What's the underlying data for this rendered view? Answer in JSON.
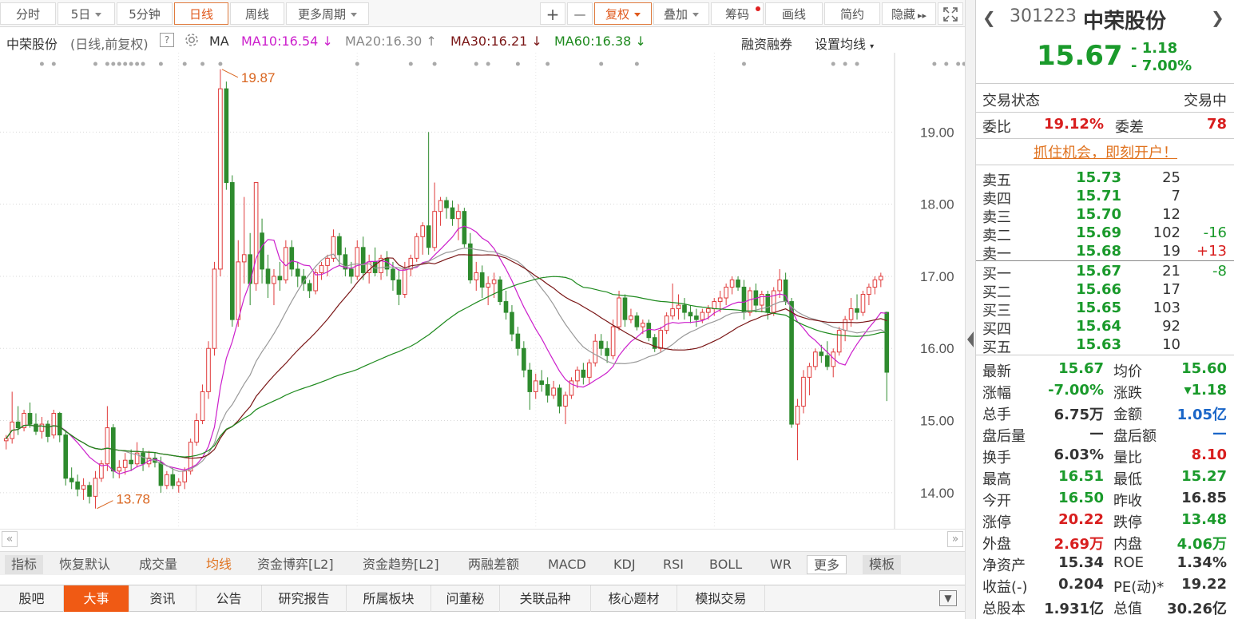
{
  "toolbar": {
    "tabs": [
      "分时",
      "5日",
      "5分钟",
      "日线",
      "周线",
      "更多周期"
    ],
    "right": [
      "+",
      "—",
      "复权",
      "叠加",
      "筹码",
      "画线",
      "简约",
      "隐藏"
    ]
  },
  "ma": {
    "title": "中荣股份",
    "subtitle": "(日线,前复权)",
    "help": "?",
    "ma": "MA",
    "ma10": "MA10:16.54",
    "ma20": "MA20:16.30",
    "ma30": "MA30:16.21",
    "ma60": "MA60:16.38",
    "rzrq": "融资融券",
    "setma": "设置均线"
  },
  "colors": {
    "up": "#e03b3b",
    "down": "#2e8b2e",
    "ma10": "#cc1fcc",
    "ma20": "#999999",
    "ma30": "#7a1616",
    "ma60": "#1e8a1e",
    "hl": "#d9651f"
  },
  "chart_data": {
    "type": "candlestick",
    "y_ticks": [
      "19.00",
      "18.00",
      "17.00",
      "16.00",
      "15.00",
      "14.00"
    ],
    "ylim": [
      13.5,
      20.1
    ],
    "high_label": "19.87",
    "low_label": "13.78",
    "ohlc": [
      [
        14.72,
        14.8,
        14.6,
        14.75
      ],
      [
        14.75,
        15.4,
        14.68,
        14.98
      ],
      [
        14.98,
        15.2,
        14.8,
        14.9
      ],
      [
        14.9,
        15.15,
        14.85,
        15.1
      ],
      [
        15.1,
        15.25,
        14.9,
        14.95
      ],
      [
        14.95,
        15.1,
        14.8,
        14.85
      ],
      [
        14.85,
        15.05,
        14.75,
        14.95
      ],
      [
        14.95,
        15.0,
        14.7,
        14.78
      ],
      [
        14.8,
        15.15,
        14.75,
        15.1
      ],
      [
        15.1,
        15.12,
        14.7,
        14.8
      ],
      [
        14.8,
        14.85,
        14.1,
        14.2
      ],
      [
        14.2,
        14.35,
        14.05,
        14.15
      ],
      [
        14.15,
        14.25,
        13.95,
        14.05
      ],
      [
        14.05,
        14.2,
        13.9,
        14.1
      ],
      [
        14.1,
        14.15,
        13.85,
        13.95
      ],
      [
        13.95,
        14.3,
        13.78,
        14.2
      ],
      [
        14.2,
        14.45,
        14.15,
        14.4
      ],
      [
        14.4,
        15.2,
        14.3,
        14.9
      ],
      [
        14.9,
        14.95,
        14.2,
        14.3
      ],
      [
        14.3,
        14.45,
        14.2,
        14.35
      ],
      [
        14.35,
        14.55,
        14.25,
        14.45
      ],
      [
        14.45,
        14.6,
        14.3,
        14.4
      ],
      [
        14.4,
        14.7,
        14.35,
        14.55
      ],
      [
        14.55,
        14.62,
        14.3,
        14.4
      ],
      [
        14.4,
        14.58,
        14.35,
        14.48
      ],
      [
        14.48,
        14.55,
        14.35,
        14.42
      ],
      [
        14.42,
        14.5,
        14.0,
        14.1
      ],
      [
        14.1,
        14.3,
        14.05,
        14.25
      ],
      [
        14.25,
        14.35,
        14.05,
        14.1
      ],
      [
        14.1,
        14.2,
        14.0,
        14.15
      ],
      [
        14.15,
        14.35,
        14.05,
        14.3
      ],
      [
        14.3,
        14.75,
        14.25,
        14.7
      ],
      [
        14.7,
        15.1,
        14.65,
        15.0
      ],
      [
        15.0,
        15.5,
        14.95,
        15.4
      ],
      [
        15.4,
        16.1,
        15.3,
        16.0
      ],
      [
        16.0,
        17.2,
        15.9,
        17.1
      ],
      [
        17.1,
        19.87,
        17.0,
        19.6
      ],
      [
        19.6,
        19.7,
        18.2,
        18.3
      ],
      [
        18.3,
        18.4,
        16.3,
        16.4
      ],
      [
        16.4,
        17.5,
        16.3,
        17.2
      ],
      [
        17.2,
        18.1,
        16.9,
        17.3
      ],
      [
        17.3,
        17.6,
        16.6,
        16.9
      ],
      [
        16.9,
        18.3,
        16.8,
        18.3
      ],
      [
        17.6,
        17.8,
        16.9,
        17.1
      ],
      [
        17.1,
        17.3,
        16.7,
        16.9
      ],
      [
        16.9,
        17.1,
        16.6,
        17.0
      ],
      [
        17.0,
        17.2,
        16.8,
        16.95
      ],
      [
        16.95,
        17.5,
        16.9,
        17.4
      ],
      [
        17.4,
        17.5,
        17.0,
        17.1
      ],
      [
        17.1,
        17.2,
        16.85,
        17.0
      ],
      [
        17.0,
        17.1,
        16.8,
        16.9
      ],
      [
        16.9,
        16.95,
        16.7,
        16.8
      ],
      [
        16.8,
        17.1,
        16.75,
        17.05
      ],
      [
        17.05,
        17.2,
        16.95,
        17.15
      ],
      [
        17.15,
        17.3,
        17.0,
        17.25
      ],
      [
        17.25,
        17.65,
        17.2,
        17.55
      ],
      [
        17.55,
        17.6,
        17.15,
        17.3
      ],
      [
        17.3,
        17.4,
        17.0,
        17.1
      ],
      [
        17.1,
        17.2,
        16.9,
        17.0
      ],
      [
        17.0,
        17.5,
        16.95,
        17.4
      ],
      [
        17.4,
        17.55,
        16.95,
        17.05
      ],
      [
        17.05,
        17.3,
        16.9,
        17.2
      ],
      [
        17.2,
        17.4,
        17.0,
        17.05
      ],
      [
        17.05,
        17.3,
        16.95,
        17.25
      ],
      [
        17.25,
        17.35,
        17.0,
        17.1
      ],
      [
        17.1,
        17.2,
        16.8,
        16.95
      ],
      [
        16.95,
        17.1,
        16.6,
        16.75
      ],
      [
        16.75,
        17.2,
        16.7,
        17.1
      ],
      [
        17.1,
        17.3,
        17.0,
        17.25
      ],
      [
        17.25,
        17.6,
        17.2,
        17.55
      ],
      [
        17.55,
        17.75,
        17.3,
        17.7
      ],
      [
        17.7,
        19.0,
        17.3,
        17.4
      ],
      [
        17.4,
        18.3,
        17.35,
        17.9
      ],
      [
        17.9,
        18.1,
        17.7,
        18.05
      ],
      [
        18.05,
        18.1,
        17.8,
        17.95
      ],
      [
        17.95,
        18.05,
        17.7,
        17.8
      ],
      [
        17.8,
        18.0,
        17.5,
        17.9
      ],
      [
        17.9,
        17.95,
        17.4,
        17.45
      ],
      [
        17.45,
        17.6,
        16.9,
        16.95
      ],
      [
        16.95,
        17.2,
        16.8,
        17.05
      ],
      [
        17.05,
        17.15,
        16.7,
        16.85
      ],
      [
        16.85,
        17.0,
        16.6,
        16.9
      ],
      [
        16.9,
        17.05,
        16.7,
        16.95
      ],
      [
        16.95,
        17.0,
        16.6,
        16.65
      ],
      [
        16.65,
        16.8,
        16.4,
        16.5
      ],
      [
        16.5,
        16.6,
        16.1,
        16.2
      ],
      [
        16.2,
        16.3,
        15.9,
        16.0
      ],
      [
        16.0,
        16.1,
        15.6,
        15.7
      ],
      [
        15.7,
        15.8,
        15.15,
        15.4
      ],
      [
        15.4,
        15.65,
        15.3,
        15.55
      ],
      [
        15.55,
        15.7,
        15.4,
        15.5
      ],
      [
        15.5,
        15.6,
        15.25,
        15.35
      ],
      [
        15.35,
        15.55,
        15.3,
        15.45
      ],
      [
        15.45,
        15.5,
        15.1,
        15.2
      ],
      [
        15.2,
        15.4,
        14.95,
        15.35
      ],
      [
        15.35,
        15.6,
        15.3,
        15.55
      ],
      [
        15.55,
        15.75,
        15.45,
        15.7
      ],
      [
        15.7,
        15.8,
        15.5,
        15.6
      ],
      [
        15.6,
        15.85,
        15.5,
        15.8
      ],
      [
        15.8,
        16.2,
        15.75,
        16.1
      ],
      [
        16.1,
        16.2,
        15.9,
        16.0
      ],
      [
        16.0,
        16.1,
        15.8,
        15.9
      ],
      [
        15.9,
        16.4,
        15.85,
        16.3
      ],
      [
        16.3,
        16.8,
        16.25,
        16.7
      ],
      [
        16.7,
        16.75,
        16.3,
        16.4
      ],
      [
        16.4,
        16.55,
        16.35,
        16.45
      ],
      [
        16.45,
        16.5,
        16.25,
        16.3
      ],
      [
        16.3,
        16.4,
        16.2,
        16.35
      ],
      [
        16.35,
        16.4,
        16.1,
        16.15
      ],
      [
        16.15,
        16.2,
        15.95,
        16.0
      ],
      [
        16.0,
        16.3,
        15.95,
        16.25
      ],
      [
        16.25,
        16.5,
        16.2,
        16.45
      ],
      [
        16.45,
        16.9,
        16.4,
        16.55
      ],
      [
        16.55,
        16.75,
        16.4,
        16.6
      ],
      [
        16.6,
        16.7,
        16.4,
        16.5
      ],
      [
        16.5,
        16.6,
        16.35,
        16.45
      ],
      [
        16.45,
        16.55,
        16.3,
        16.4
      ],
      [
        16.4,
        16.55,
        16.35,
        16.5
      ],
      [
        16.5,
        16.6,
        16.4,
        16.55
      ],
      [
        16.55,
        16.7,
        16.45,
        16.65
      ],
      [
        16.65,
        16.8,
        16.5,
        16.7
      ],
      [
        16.7,
        16.9,
        16.6,
        16.85
      ],
      [
        16.85,
        17.0,
        16.75,
        16.95
      ],
      [
        16.95,
        17.0,
        16.8,
        16.85
      ],
      [
        16.85,
        16.95,
        16.4,
        16.5
      ],
      [
        16.5,
        16.85,
        16.45,
        16.8
      ],
      [
        16.8,
        16.9,
        16.5,
        16.6
      ],
      [
        16.6,
        16.8,
        16.5,
        16.75
      ],
      [
        16.75,
        16.8,
        16.4,
        16.5
      ],
      [
        16.5,
        16.85,
        16.45,
        16.8
      ],
      [
        16.8,
        17.1,
        16.7,
        16.95
      ],
      [
        16.95,
        17.05,
        16.6,
        16.65
      ],
      [
        16.65,
        16.7,
        14.9,
        14.95
      ],
      [
        14.95,
        15.3,
        14.45,
        15.2
      ],
      [
        15.2,
        15.7,
        15.1,
        15.6
      ],
      [
        15.6,
        15.8,
        15.35,
        15.75
      ],
      [
        15.75,
        16.0,
        15.7,
        15.95
      ],
      [
        15.95,
        16.05,
        15.8,
        15.9
      ],
      [
        15.9,
        16.1,
        15.7,
        15.75
      ],
      [
        15.75,
        16.0,
        15.6,
        15.95
      ],
      [
        15.95,
        16.3,
        15.9,
        16.25
      ],
      [
        16.25,
        16.45,
        16.1,
        16.4
      ],
      [
        16.4,
        16.7,
        16.3,
        16.55
      ],
      [
        16.55,
        16.75,
        16.4,
        16.5
      ],
      [
        16.5,
        16.8,
        16.45,
        16.75
      ],
      [
        16.75,
        16.9,
        16.6,
        16.85
      ],
      [
        16.85,
        17.0,
        16.75,
        16.95
      ],
      [
        16.95,
        17.05,
        16.85,
        17.0
      ],
      [
        16.5,
        16.51,
        15.27,
        15.67
      ]
    ]
  },
  "right": {
    "code": "301223",
    "name": "中荣股份",
    "price": "15.67",
    "chg": "- 1.18",
    "pct": "- 7.00%",
    "status_label": "交易状态",
    "status": "交易中",
    "wb_label": "委比",
    "wb": "19.12%",
    "wc_label": "委差",
    "wc": "78",
    "ad": "抓住机会，即刻开户！",
    "sell": [
      {
        "label": "卖五",
        "price": "15.73",
        "vol": "25",
        "chg": ""
      },
      {
        "label": "卖四",
        "price": "15.71",
        "vol": "7",
        "chg": ""
      },
      {
        "label": "卖三",
        "price": "15.70",
        "vol": "12",
        "chg": ""
      },
      {
        "label": "卖二",
        "price": "15.69",
        "vol": "102",
        "chg": "-16"
      },
      {
        "label": "卖一",
        "price": "15.68",
        "vol": "19",
        "chg": "+13"
      }
    ],
    "buy": [
      {
        "label": "买一",
        "price": "15.67",
        "vol": "21",
        "chg": "-8"
      },
      {
        "label": "买二",
        "price": "15.66",
        "vol": "17",
        "chg": ""
      },
      {
        "label": "买三",
        "price": "15.65",
        "vol": "103",
        "chg": ""
      },
      {
        "label": "买四",
        "price": "15.64",
        "vol": "92",
        "chg": ""
      },
      {
        "label": "买五",
        "price": "15.63",
        "vol": "10",
        "chg": ""
      }
    ],
    "stats": [
      [
        "最新",
        "15.67",
        "g",
        "均价",
        "15.60",
        "g"
      ],
      [
        "涨幅",
        "-7.00%",
        "g",
        "涨跌",
        "▾1.18",
        "g"
      ],
      [
        "总手",
        "6.75万",
        "k",
        "金额",
        "1.05亿",
        "b"
      ],
      [
        "盘后量",
        "—",
        "k",
        "盘后额",
        "—",
        "b"
      ],
      [
        "换手",
        "6.03%",
        "k",
        "量比",
        "8.10",
        "r"
      ],
      [
        "最高",
        "16.51",
        "g",
        "最低",
        "15.27",
        "g"
      ],
      [
        "今开",
        "16.50",
        "g",
        "昨收",
        "16.85",
        "k"
      ],
      [
        "涨停",
        "20.22",
        "r",
        "跌停",
        "13.48",
        "g"
      ],
      [
        "外盘",
        "2.69万",
        "r",
        "内盘",
        "4.06万",
        "g"
      ],
      [
        "净资产",
        "15.34",
        "k",
        "ROE",
        "1.34%",
        "k"
      ],
      [
        "收益(-)",
        "0.204",
        "k",
        "PE(动)*",
        "19.22",
        "k"
      ],
      [
        "总股本",
        "1.931亿",
        "k",
        "总值",
        "30.26亿",
        "k"
      ]
    ]
  },
  "indicators": [
    "指标",
    "恢复默认",
    "成交量",
    "均线",
    "资金博弈[L2]",
    "资金趋势[L2]",
    "两融差额",
    "MACD",
    "KDJ",
    "RSI",
    "BOLL",
    "WR",
    "更多",
    "模板"
  ],
  "news_tabs": [
    "股吧",
    "大事",
    "资讯",
    "公告",
    "研究报告",
    "所属板块",
    "问董秘",
    "关联品种",
    "核心题材",
    "模拟交易"
  ]
}
